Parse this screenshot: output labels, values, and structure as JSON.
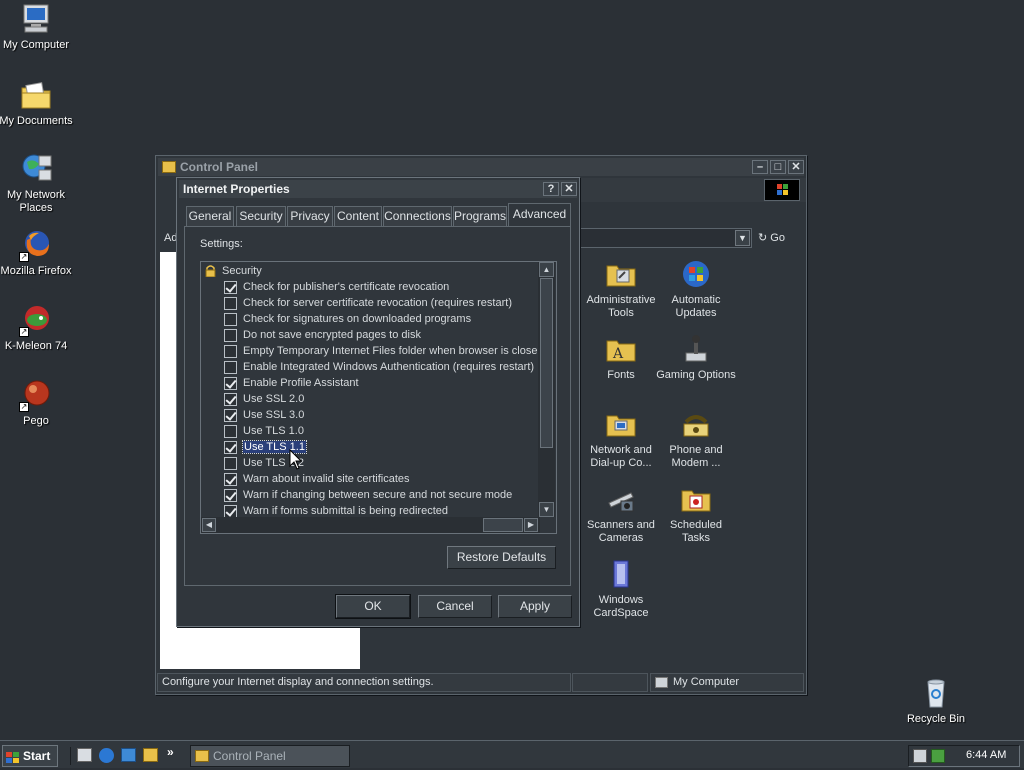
{
  "desktop": {
    "icons": [
      {
        "label": "My Computer"
      },
      {
        "label": "My Documents"
      },
      {
        "label": "My Network Places"
      },
      {
        "label": "Mozilla Firefox"
      },
      {
        "label": "K-Meleon 74"
      },
      {
        "label": "Pego"
      },
      {
        "label": "Recycle Bin"
      }
    ]
  },
  "control_panel": {
    "title": "Control Panel",
    "address_prefix": "Ad",
    "go_label": "Go",
    "icons": [
      {
        "label": "Administrative Tools",
        "icon": "admin-tools-icon"
      },
      {
        "label": "Automatic Updates",
        "icon": "automatic-updates-icon"
      },
      {
        "label": "Fonts",
        "icon": "fonts-icon"
      },
      {
        "label": "Gaming Options",
        "icon": "gaming-options-icon"
      },
      {
        "label": "Network and Dial-up Co...",
        "icon": "network-dialup-icon"
      },
      {
        "label": "Phone and Modem ...",
        "icon": "phone-modem-icon"
      },
      {
        "label": "Scanners and Cameras",
        "icon": "scanners-cameras-icon"
      },
      {
        "label": "Scheduled Tasks",
        "icon": "scheduled-tasks-icon"
      },
      {
        "label": "Windows CardSpace",
        "icon": "cardspace-icon"
      }
    ],
    "status_text": "Configure your Internet display and connection settings.",
    "status_location": "My Computer"
  },
  "internet_properties": {
    "title": "Internet Properties",
    "tabs": [
      {
        "label": "General"
      },
      {
        "label": "Security"
      },
      {
        "label": "Privacy"
      },
      {
        "label": "Content"
      },
      {
        "label": "Connections"
      },
      {
        "label": "Programs"
      },
      {
        "label": "Advanced"
      }
    ],
    "active_tab": "Advanced",
    "settings_label": "Settings:",
    "group_label": "Security",
    "options": [
      {
        "label": "Check for publisher's certificate revocation",
        "checked": true
      },
      {
        "label": "Check for server certificate revocation (requires restart)",
        "checked": false
      },
      {
        "label": "Check for signatures on downloaded programs",
        "checked": false
      },
      {
        "label": "Do not save encrypted pages to disk",
        "checked": false
      },
      {
        "label": "Empty Temporary Internet Files folder when browser is closed",
        "checked": false
      },
      {
        "label": "Enable Integrated Windows Authentication (requires restart)",
        "checked": false
      },
      {
        "label": "Enable Profile Assistant",
        "checked": true
      },
      {
        "label": "Use SSL 2.0",
        "checked": true
      },
      {
        "label": "Use SSL 3.0",
        "checked": true
      },
      {
        "label": "Use TLS 1.0",
        "checked": false
      },
      {
        "label": "Use TLS 1.1",
        "checked": true,
        "selected": true
      },
      {
        "label": "Use TLS 1.2",
        "checked": false
      },
      {
        "label": "Warn about invalid site certificates",
        "checked": true
      },
      {
        "label": "Warn if changing between secure and not secure mode",
        "checked": true
      },
      {
        "label": "Warn if forms submittal is being redirected",
        "checked": true
      }
    ],
    "restore_defaults_label": "Restore Defaults",
    "ok_label": "OK",
    "cancel_label": "Cancel",
    "apply_label": "Apply"
  },
  "taskbar": {
    "start_label": "Start",
    "task_label": "Control Panel",
    "clock": "6:44 AM"
  }
}
